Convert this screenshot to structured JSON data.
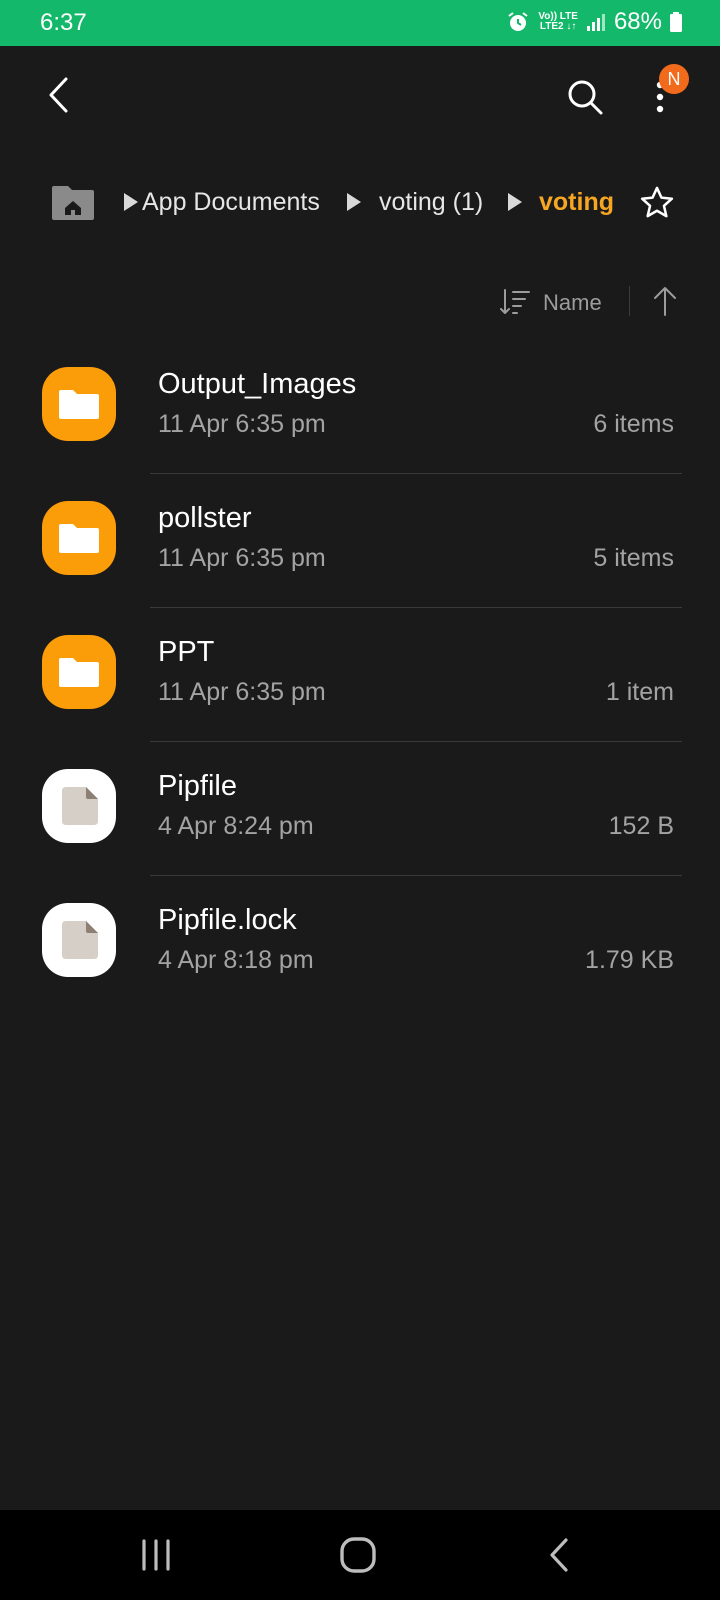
{
  "status_bar": {
    "time": "6:37",
    "network_top": "Vo)) LTE",
    "network_bottom": "LTE2 ↓↑",
    "battery": "68%"
  },
  "toolbar": {
    "back_icon": "back-chevron-icon",
    "search_icon": "search-icon",
    "more_icon": "more-vertical-icon",
    "notification_badge": "N"
  },
  "breadcrumb": {
    "home_icon": "home-folder-icon",
    "items": [
      "App Documents",
      "voting (1)",
      "voting"
    ],
    "favorite_icon": "star-outline-icon"
  },
  "sort": {
    "label": "Name"
  },
  "files": [
    {
      "name": "Output_Images",
      "date": "11 Apr 6:35 pm",
      "meta": "6 items",
      "type": "folder"
    },
    {
      "name": "pollster",
      "date": "11 Apr 6:35 pm",
      "meta": "5 items",
      "type": "folder"
    },
    {
      "name": "PPT",
      "date": "11 Apr 6:35 pm",
      "meta": "1 item",
      "type": "folder"
    },
    {
      "name": "Pipfile",
      "date": "4 Apr 8:24 pm",
      "meta": "152 B",
      "type": "file"
    },
    {
      "name": "Pipfile.lock",
      "date": "4 Apr 8:18 pm",
      "meta": "1.79 KB",
      "type": "file"
    }
  ],
  "colors": {
    "status_bar": "#14b86a",
    "background": "#1a1a1a",
    "folder": "#fb9c09",
    "current_crumb": "#f6a623",
    "badge": "#f26b1d"
  }
}
